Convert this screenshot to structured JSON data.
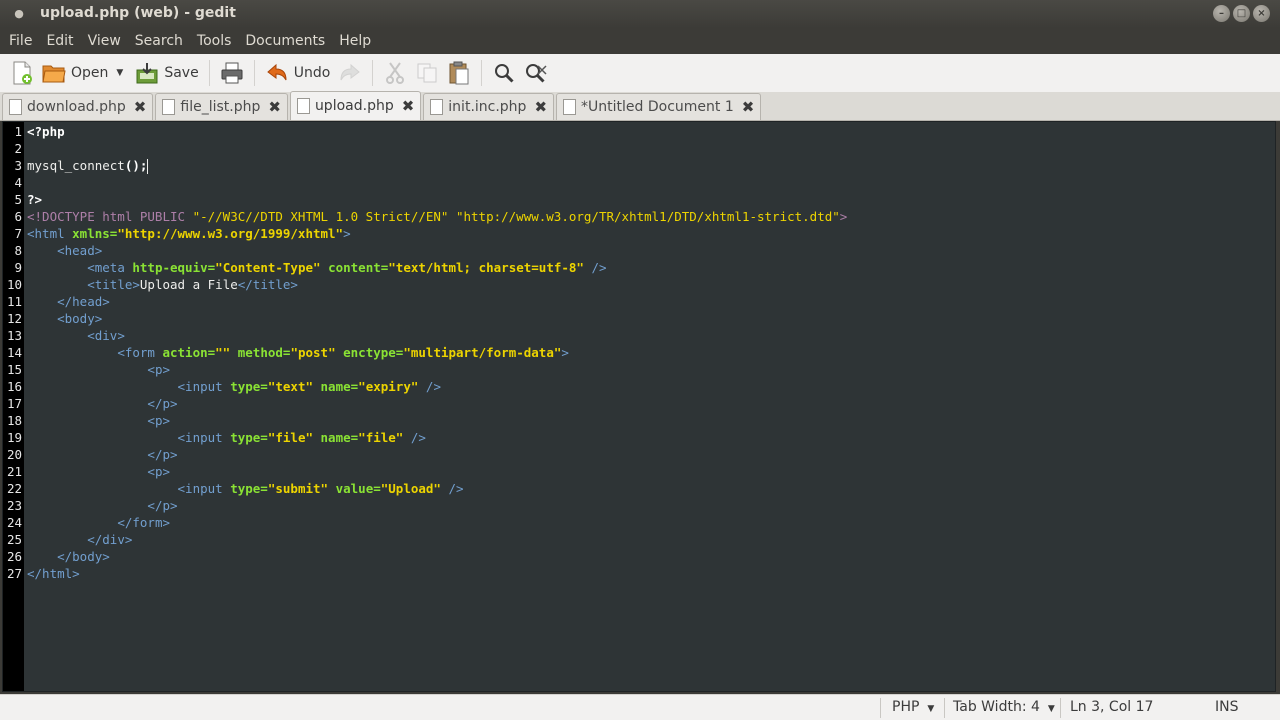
{
  "window": {
    "title": "upload.php (web) - gedit"
  },
  "menu": [
    "File",
    "Edit",
    "View",
    "Search",
    "Tools",
    "Documents",
    "Help"
  ],
  "toolbar": {
    "open_label": "Open",
    "save_label": "Save",
    "undo_label": "Undo"
  },
  "tabs": [
    {
      "label": "download.php"
    },
    {
      "label": "file_list.php"
    },
    {
      "label": "upload.php"
    },
    {
      "label": "init.inc.php"
    },
    {
      "label": "*Untitled Document 1"
    }
  ],
  "editor": {
    "lines": [
      [
        [
          "php",
          "<?php"
        ]
      ],
      [],
      [
        [
          "txt",
          "mysql_connect"
        ],
        [
          "php",
          "();"
        ]
      ],
      [],
      [
        [
          "php",
          "?>"
        ]
      ],
      [
        [
          "doc",
          "<!DOCTYPE html PUBLIC "
        ],
        [
          "str0",
          "\"-//W3C//DTD XHTML 1.0 Strict//EN\" \"http://www.w3.org/TR/xhtml1/DTD/xhtml1-strict.dtd\""
        ],
        [
          "doc",
          ">"
        ]
      ],
      [
        [
          "tag",
          "<html "
        ],
        [
          "attr",
          "xmlns="
        ],
        [
          "str",
          "\"http://www.w3.org/1999/xhtml\""
        ],
        [
          "tag",
          ">"
        ]
      ],
      [
        [
          "txt",
          "    "
        ],
        [
          "tag",
          "<head>"
        ]
      ],
      [
        [
          "txt",
          "        "
        ],
        [
          "tag",
          "<meta "
        ],
        [
          "attr",
          "http-equiv="
        ],
        [
          "str",
          "\"Content-Type\""
        ],
        [
          "txt",
          " "
        ],
        [
          "attr",
          "content="
        ],
        [
          "str",
          "\"text/html; charset=utf-8\""
        ],
        [
          "tag",
          " />"
        ]
      ],
      [
        [
          "txt",
          "        "
        ],
        [
          "tag",
          "<title>"
        ],
        [
          "txt",
          "Upload a File"
        ],
        [
          "tag",
          "</title>"
        ]
      ],
      [
        [
          "txt",
          "    "
        ],
        [
          "tag",
          "</head>"
        ]
      ],
      [
        [
          "txt",
          "    "
        ],
        [
          "tag",
          "<body>"
        ]
      ],
      [
        [
          "txt",
          "        "
        ],
        [
          "tag",
          "<div>"
        ]
      ],
      [
        [
          "txt",
          "            "
        ],
        [
          "tag",
          "<form "
        ],
        [
          "attr",
          "action="
        ],
        [
          "str",
          "\"\""
        ],
        [
          "txt",
          " "
        ],
        [
          "attr",
          "method="
        ],
        [
          "str",
          "\"post\""
        ],
        [
          "txt",
          " "
        ],
        [
          "attr",
          "enctype="
        ],
        [
          "str",
          "\"multipart/form-data\""
        ],
        [
          "tag",
          ">"
        ]
      ],
      [
        [
          "txt",
          "                "
        ],
        [
          "tag",
          "<p>"
        ]
      ],
      [
        [
          "txt",
          "                    "
        ],
        [
          "tag",
          "<input "
        ],
        [
          "attr",
          "type="
        ],
        [
          "str",
          "\"text\""
        ],
        [
          "txt",
          " "
        ],
        [
          "attr",
          "name="
        ],
        [
          "str",
          "\"expiry\""
        ],
        [
          "tag",
          " />"
        ]
      ],
      [
        [
          "txt",
          "                "
        ],
        [
          "tag",
          "</p>"
        ]
      ],
      [
        [
          "txt",
          "                "
        ],
        [
          "tag",
          "<p>"
        ]
      ],
      [
        [
          "txt",
          "                    "
        ],
        [
          "tag",
          "<input "
        ],
        [
          "attr",
          "type="
        ],
        [
          "str",
          "\"file\""
        ],
        [
          "txt",
          " "
        ],
        [
          "attr",
          "name="
        ],
        [
          "str",
          "\"file\""
        ],
        [
          "tag",
          " />"
        ]
      ],
      [
        [
          "txt",
          "                "
        ],
        [
          "tag",
          "</p>"
        ]
      ],
      [
        [
          "txt",
          "                "
        ],
        [
          "tag",
          "<p>"
        ]
      ],
      [
        [
          "txt",
          "                    "
        ],
        [
          "tag",
          "<input "
        ],
        [
          "attr",
          "type="
        ],
        [
          "str",
          "\"submit\""
        ],
        [
          "txt",
          " "
        ],
        [
          "attr",
          "value="
        ],
        [
          "str",
          "\"Upload\""
        ],
        [
          "tag",
          " />"
        ]
      ],
      [
        [
          "txt",
          "                "
        ],
        [
          "tag",
          "</p>"
        ]
      ],
      [
        [
          "txt",
          "            "
        ],
        [
          "tag",
          "</form>"
        ]
      ],
      [
        [
          "txt",
          "        "
        ],
        [
          "tag",
          "</div>"
        ]
      ],
      [
        [
          "txt",
          "    "
        ],
        [
          "tag",
          "</body>"
        ]
      ],
      [
        [
          "tag",
          "</html>"
        ]
      ]
    ],
    "cursor_line": 3,
    "cursor_after_segment": 1
  },
  "statusbar": {
    "language": "PHP",
    "tab_width": "Tab Width: 4",
    "position": "Ln 3, Col 17",
    "mode": "INS"
  },
  "colors": {
    "editor_bg": "#2e3436",
    "tag": "#729fcf",
    "attribute": "#8ae234",
    "string": "#edd400",
    "doctype": "#ad7fa8"
  }
}
